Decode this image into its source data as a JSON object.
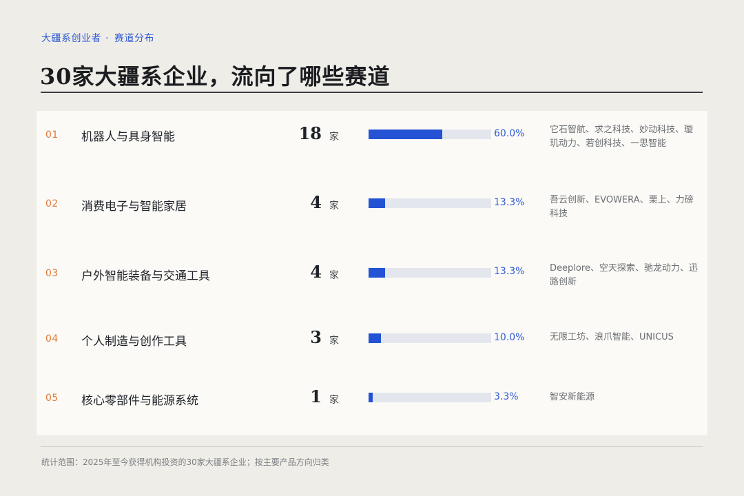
{
  "header": {
    "kicker_left": "大疆系创业者",
    "kicker_sep": "·",
    "kicker_right": "赛道分布",
    "title": "30家大疆系企业，流向了哪些赛道"
  },
  "rows": [
    {
      "index": "01",
      "name": "机器人与具身智能",
      "count": "18",
      "unit": "家",
      "percent_label": "60.0%",
      "share": 0.6,
      "companies": "它石智航、求之科技、妙动科技、璇玑动力、若创科技、一思智能"
    },
    {
      "index": "02",
      "name": "消费电子与智能家居",
      "count": "4",
      "unit": "家",
      "percent_label": "13.3%",
      "share": 0.133,
      "companies": "吾云创新、EVOWERA、栗上、力磅科技"
    },
    {
      "index": "03",
      "name": "户外智能装备与交通工具",
      "count": "4",
      "unit": "家",
      "percent_label": "13.3%",
      "share": 0.133,
      "companies": "Deeplore、空天探索、驰龙动力、迅路创新"
    },
    {
      "index": "04",
      "name": "个人制造与创作工具",
      "count": "3",
      "unit": "家",
      "percent_label": "10.0%",
      "share": 0.1,
      "companies": "无限工坊、浪爪智能、UNICUS"
    },
    {
      "index": "05",
      "name": "核心零部件与能源系统",
      "count": "1",
      "unit": "家",
      "percent_label": "3.3%",
      "share": 0.033,
      "companies": "智安新能源"
    }
  ],
  "footer": {
    "note": "统计范围：2025年至今获得机构投资的30家大疆系企业；按主要产品方向归类"
  },
  "colors": {
    "accent_blue": "#2352d4",
    "index_orange": "#e07a3b",
    "track": "#e4e6ee",
    "row_bg": "#fbfaf6",
    "page_bg": "#efede7"
  }
}
